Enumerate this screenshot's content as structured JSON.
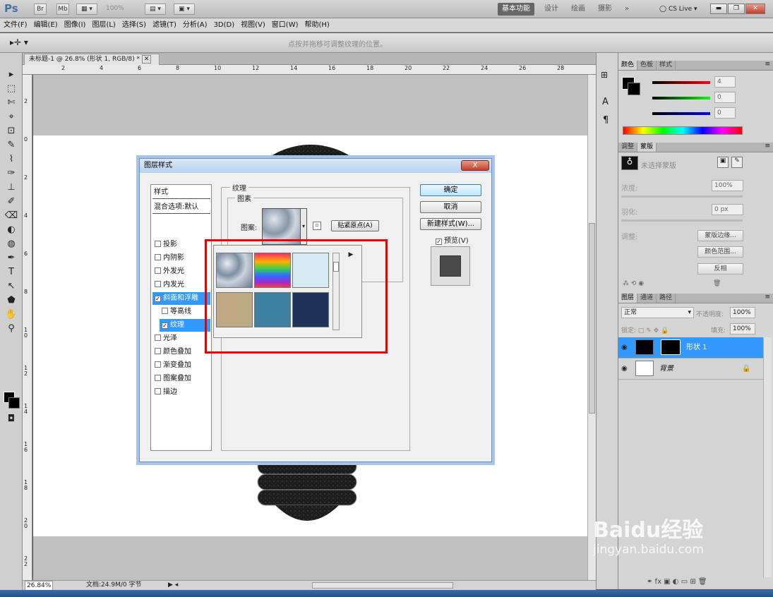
{
  "app": {
    "logo": "Ps",
    "zoom_box": "100%"
  },
  "workspaces": [
    {
      "label": "基本功能",
      "active": true
    },
    {
      "label": "设计",
      "active": false
    },
    {
      "label": "绘画",
      "active": false
    },
    {
      "label": "摄影",
      "active": false
    },
    {
      "label": "»",
      "active": false
    }
  ],
  "cslive": "CS Live",
  "menu": [
    "文件(F)",
    "编辑(E)",
    "图像(I)",
    "图层(L)",
    "选择(S)",
    "滤镜(T)",
    "分析(A)",
    "3D(D)",
    "视图(V)",
    "窗口(W)",
    "帮助(H)"
  ],
  "options_hint": "点按并拖移可调整纹理的位置。",
  "doc_tab": "未标题-1 @ 26.8% (形状 1, RGB/8) *",
  "ruler_top": [
    "2",
    "4",
    "6",
    "8",
    "10",
    "12",
    "14",
    "16",
    "18",
    "20",
    "22",
    "24",
    "26",
    "28"
  ],
  "ruler_left": [
    "2",
    "0",
    "2",
    "4",
    "6",
    "8",
    "1\n0",
    "1\n2",
    "1\n4",
    "1\n6",
    "1\n8",
    "2\n0",
    "2\n2"
  ],
  "status": {
    "zoom": "26.84%",
    "doc": "文档:24.9M/0 字节"
  },
  "color_panel": {
    "tabs": [
      "颜色",
      "色板",
      "样式"
    ],
    "r": "4",
    "g": "0",
    "b": "0"
  },
  "mask_panel": {
    "tabs": [
      "调整",
      "蒙版"
    ],
    "no_mask": "未选择蒙版",
    "density_label": "浓度:",
    "density": "100%",
    "feather_label": "羽化:",
    "feather": "0 px",
    "refine_label": "调整:",
    "btn_edge": "蒙版边缘...",
    "btn_range": "颜色范围...",
    "btn_invert": "反相"
  },
  "layers_panel": {
    "tabs": [
      "图层",
      "通道",
      "路径"
    ],
    "blend": "正常",
    "opacity_label": "不透明度:",
    "opacity": "100%",
    "lock_label": "锁定:",
    "fill_label": "填充:",
    "fill": "100%",
    "layers": [
      {
        "name": "形状 1",
        "selected": true
      },
      {
        "name": "背景",
        "selected": false
      }
    ]
  },
  "dialog": {
    "title": "图层样式",
    "close": "X",
    "styles_header": "样式",
    "blend_default": "混合选项:默认",
    "items": [
      {
        "label": "投影",
        "checked": false
      },
      {
        "label": "内阴影",
        "checked": false
      },
      {
        "label": "外发光",
        "checked": false
      },
      {
        "label": "内发光",
        "checked": false
      },
      {
        "label": "斜面和浮雕",
        "checked": true,
        "sel": true
      },
      {
        "label": "等高线",
        "checked": false,
        "sub": true
      },
      {
        "label": "纹理",
        "checked": true,
        "sub": true,
        "sel": true
      },
      {
        "label": "光泽",
        "checked": false
      },
      {
        "label": "颜色叠加",
        "checked": false
      },
      {
        "label": "渐变叠加",
        "checked": false
      },
      {
        "label": "图案叠加",
        "checked": false
      },
      {
        "label": "描边",
        "checked": false
      }
    ],
    "group_texture": "纹理",
    "group_pattern": "图素",
    "pattern_label": "图案:",
    "snap_button": "贴紧原点(A)",
    "ok": "确定",
    "cancel": "取消",
    "new_style": "新建样式(W)...",
    "preview": "预览(V)"
  },
  "watermark": {
    "brand": "Baidu",
    "brand_cn": "经验",
    "url": "jingyan.baidu.com"
  }
}
